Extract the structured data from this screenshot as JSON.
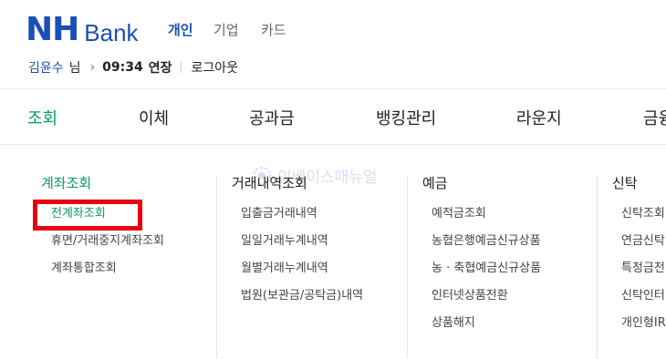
{
  "header": {
    "logo_mark": "NH",
    "logo_text": "Bank",
    "segments": [
      "개인",
      "기업",
      "카드"
    ]
  },
  "user": {
    "name": "김윤수",
    "suffix": "님",
    "arrow": "›",
    "time": "09:34",
    "extend": "연장",
    "logout": "로그아웃"
  },
  "gnb": [
    "조회",
    "이체",
    "공과금",
    "뱅킹관리",
    "라운지",
    "금융"
  ],
  "columns": [
    {
      "head": "계좌조회",
      "links": [
        "전계좌조회",
        "휴면/거래중지계좌조회",
        "계좌통합조회"
      ]
    },
    {
      "head": "거래내역조회",
      "links": [
        "입출금거래내역",
        "일일거래누계내역",
        "월별거래누계내역",
        "법원(보관금/공탁금)내역"
      ]
    },
    {
      "head": "예금",
      "links": [
        "예적금조회",
        "농협은행예금신규상품",
        "농 · 축협예금신규상품",
        "인터넷상품전환",
        "상품해지"
      ]
    },
    {
      "head": "신탁",
      "links": [
        "신탁조회",
        "연금신탁",
        "특정금전",
        "신탁인터",
        "개인형IR"
      ]
    }
  ],
  "watermark": "이베이스매뉴얼",
  "colors": {
    "brand_blue": "#1a4fb6",
    "accent_green": "#0a9a5a",
    "highlight_red": "#e50012"
  }
}
